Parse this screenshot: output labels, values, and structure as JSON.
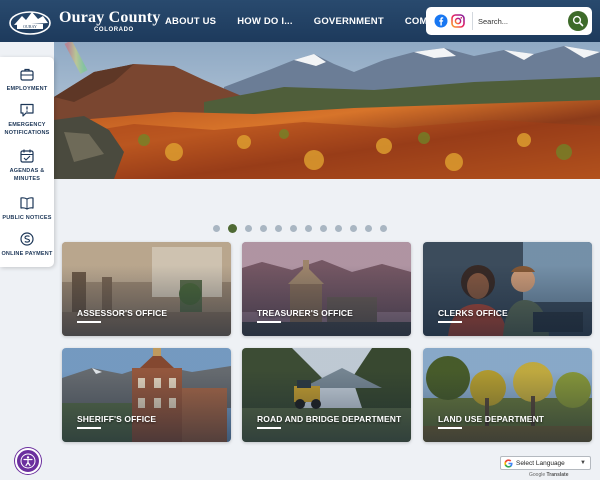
{
  "site": {
    "name": "Ouray County",
    "subtitle": "COLORADO"
  },
  "nav": {
    "items": [
      {
        "label": "ABOUT US"
      },
      {
        "label": "HOW DO I..."
      },
      {
        "label": "GOVERNMENT"
      },
      {
        "label": "COMMUNITY"
      }
    ]
  },
  "search": {
    "placeholder": "Search...",
    "social": [
      "facebook-icon",
      "instagram-icon"
    ]
  },
  "sidebar": {
    "items": [
      {
        "label": "EMPLOYMENT",
        "icon": "briefcase-icon"
      },
      {
        "label": "EMERGENCY NOTIFICATIONS",
        "icon": "chat-alert-icon"
      },
      {
        "label": "AGENDAS & MINUTES",
        "icon": "calendar-icon"
      },
      {
        "label": "PUBLIC NOTICES",
        "icon": "book-icon"
      },
      {
        "label": "ONLINE PAYMENT",
        "icon": "payment-icon"
      }
    ]
  },
  "slider": {
    "dot_count": 12,
    "active_index": 1
  },
  "cards": [
    {
      "label": "ASSESSOR'S OFFICE"
    },
    {
      "label": "TREASURER'S OFFICE"
    },
    {
      "label": "CLERKS OFFICE"
    },
    {
      "label": "SHERIFF'S OFFICE"
    },
    {
      "label": "ROAD AND BRIDGE DEPARTMENT"
    },
    {
      "label": "LAND USE DEPARTMENT"
    }
  ],
  "translate": {
    "select_label": "Select Language",
    "powered_by": "Google",
    "powered_suffix": "Translate"
  },
  "colors": {
    "header": "#1d3a5c",
    "accent_green": "#3e6b2a",
    "accessibility_purple": "#6b2f9e"
  }
}
